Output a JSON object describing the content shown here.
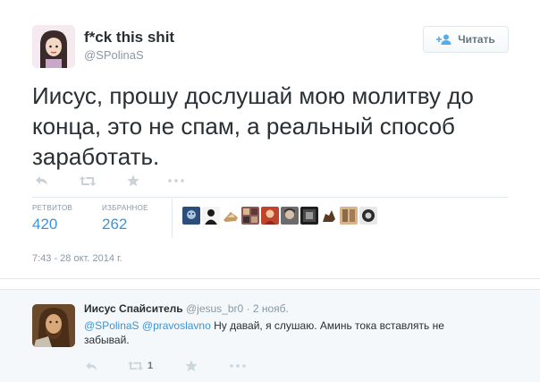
{
  "tweet": {
    "author_name": "f*ck this shit",
    "author_handle": "@SPolinaS",
    "follow_label": "Читать",
    "text": "Иисус, прошу дослушай мою молитву до конца, это не спам, а реальный способ заработать.",
    "actions": [
      "reply-icon",
      "retweet-icon",
      "favorite-icon",
      "more-icon"
    ],
    "stats": {
      "retweets_label": "РЕТВИТОВ",
      "retweets": "420",
      "favorites_label": "ИЗБРАННОЕ",
      "favorites": "262"
    },
    "timestamp": "7:43 - 28 окт. 2014 г."
  },
  "reply": {
    "author_name": "Иисус Спайситель",
    "author_handle": "@jesus_br0",
    "time": "· 2 нояб.",
    "mention_1": "@SPolinaS",
    "mention_2": "@pravoslavno",
    "text": "Ну давай, я слушаю. Аминь тока вставлять не забывай.",
    "retweet_count": "1"
  },
  "colors": {
    "link": "#3b94d9",
    "muted": "#8899a6",
    "text": "#292f33",
    "reply_bg": "#f5f8fa"
  }
}
